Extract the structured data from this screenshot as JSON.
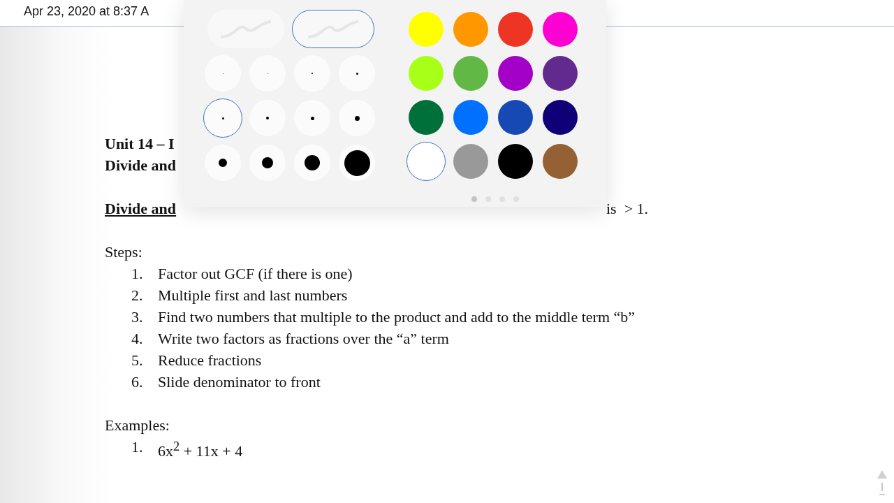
{
  "header": {
    "timestamp": "Apr 23, 2020 at 8:37 A"
  },
  "tool_palette": {
    "strokes": [
      {
        "selected": false
      },
      {
        "selected": true
      }
    ],
    "sizes": [
      {
        "selected": false
      },
      {
        "selected": false
      },
      {
        "selected": false
      },
      {
        "selected": false
      },
      {
        "selected": true
      },
      {
        "selected": false
      },
      {
        "selected": false
      },
      {
        "selected": false
      },
      {
        "selected": false
      },
      {
        "selected": false
      },
      {
        "selected": false
      },
      {
        "selected": false
      }
    ],
    "colors": [
      {
        "color": "#ffff00",
        "selected": false
      },
      {
        "color": "#ff9800",
        "selected": false
      },
      {
        "color": "#ee3524",
        "selected": false
      },
      {
        "color": "#ff00d2",
        "selected": false
      },
      {
        "color": "#a8ff18",
        "selected": false
      },
      {
        "color": "#61b845",
        "selected": false
      },
      {
        "color": "#a300c8",
        "selected": false
      },
      {
        "color": "#622a8e",
        "selected": false
      },
      {
        "color": "#00703a",
        "selected": false
      },
      {
        "color": "#0070ff",
        "selected": false
      },
      {
        "color": "#1749b5",
        "selected": false
      },
      {
        "color": "#100078",
        "selected": false
      },
      {
        "color": "#ffffff",
        "selected": true
      },
      {
        "color": "#999999",
        "selected": false
      },
      {
        "color": "#000000",
        "selected": false
      },
      {
        "color": "#936134",
        "selected": false
      }
    ],
    "pages": [
      {
        "selected": true
      },
      {
        "selected": false
      },
      {
        "selected": false
      },
      {
        "selected": false
      }
    ]
  },
  "document": {
    "title_lines": [
      "Unit 14 – I",
      "Divide and"
    ],
    "definition": {
      "term": "Divide and",
      "rest": "is  > 1."
    },
    "steps_label": "Steps:",
    "steps": [
      {
        "number": "1.",
        "text": "Factor out GCF (if there is one)"
      },
      {
        "number": "2.",
        "text": "Multiple first and last numbers"
      },
      {
        "number": "3.",
        "text": "Find two numbers that multiple to the product and add to the middle term “b”"
      },
      {
        "number": "4.",
        "text": "Write two factors as fractions over the “a” term"
      },
      {
        "number": "5.",
        "text": "Reduce fractions"
      },
      {
        "number": "6.",
        "text": "Slide denominator to front"
      }
    ],
    "examples_label": "Examples:",
    "examples": [
      {
        "number": "1.",
        "text": "6x$^{2}$ + 11x + 4"
      }
    ]
  }
}
